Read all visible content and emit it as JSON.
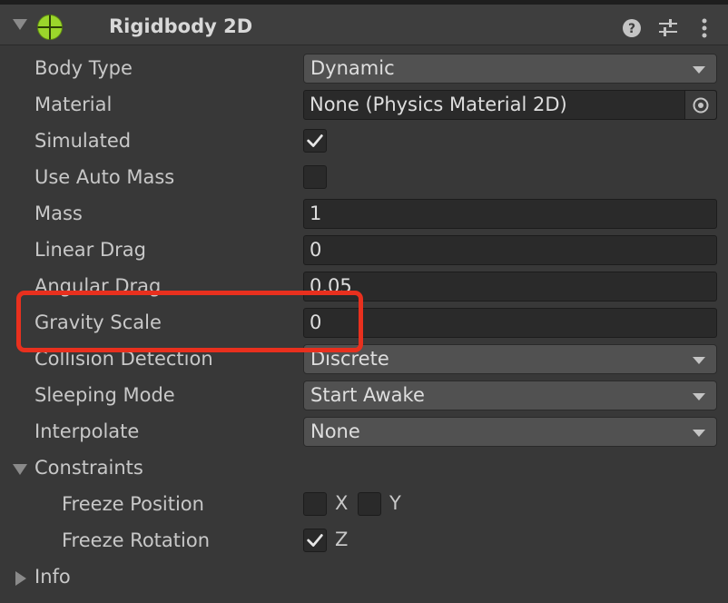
{
  "component": {
    "title": "Rigidbody 2D",
    "header_icons": [
      "help-icon",
      "presets-icon",
      "more-options-icon"
    ]
  },
  "properties": {
    "body_type": {
      "label": "Body Type",
      "value": "Dynamic"
    },
    "material": {
      "label": "Material",
      "value": "None (Physics Material 2D)"
    },
    "simulated": {
      "label": "Simulated",
      "checked": true
    },
    "use_auto_mass": {
      "label": "Use Auto Mass",
      "checked": false
    },
    "mass": {
      "label": "Mass",
      "value": "1"
    },
    "linear_drag": {
      "label": "Linear Drag",
      "value": "0"
    },
    "angular_drag": {
      "label": "Angular Drag",
      "value": "0.05"
    },
    "gravity_scale": {
      "label": "Gravity Scale",
      "value": "0"
    },
    "collision_detection": {
      "label": "Collision Detection",
      "value": "Discrete"
    },
    "sleeping_mode": {
      "label": "Sleeping Mode",
      "value": "Start Awake"
    },
    "interpolate": {
      "label": "Interpolate",
      "value": "None"
    }
  },
  "constraints": {
    "label": "Constraints",
    "expanded": true,
    "freeze_position": {
      "label": "Freeze Position",
      "x_label": "X",
      "y_label": "Y",
      "x": false,
      "y": false
    },
    "freeze_rotation": {
      "label": "Freeze Rotation",
      "z_label": "Z",
      "z": true
    }
  },
  "info": {
    "label": "Info",
    "expanded": false
  },
  "colors": {
    "background": "#383838",
    "header": "#3e3e3e",
    "field": "#2a2a2a",
    "dropdown": "#515151",
    "highlight": "#e8301e",
    "icon_green": "#9bd62b"
  }
}
